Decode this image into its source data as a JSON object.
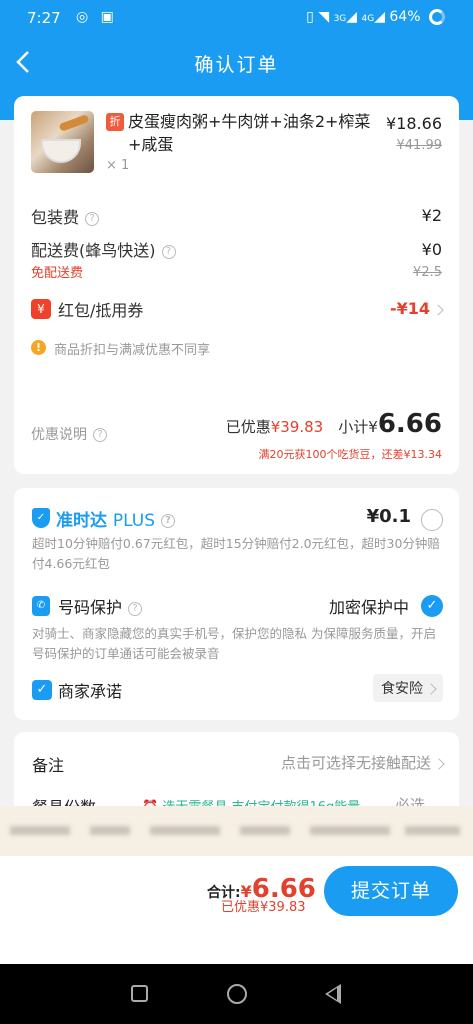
{
  "status": {
    "time": "7:27",
    "battery": "64%",
    "net1": "3G",
    "net2": "4G"
  },
  "nav": {
    "title": "确认订单"
  },
  "product": {
    "badge": "折",
    "name": "皮蛋瘦肉粥+牛肉饼+油条2+榨菜+咸蛋",
    "qty": "× 1",
    "price": "¥18.66",
    "orig_price": "¥41.99"
  },
  "fees": {
    "packing_label": "包装费",
    "packing_value": "¥2",
    "delivery_label": "配送费(蜂鸟快送)",
    "delivery_value": "¥0",
    "free_delivery": "免配送费",
    "delivery_orig": "¥2.5",
    "coupon_badge": "¥",
    "coupon_label": "红包/抵用券",
    "coupon_value": "-¥14",
    "notice": "商品折扣与满减优惠不同享"
  },
  "summary": {
    "desc_label": "优惠说明",
    "saved_prefix": "已优惠",
    "saved_value": "¥39.83",
    "subtotal_prefix": "小计¥",
    "subtotal_value": "6.66",
    "promo": "满20元获100个吃货豆，还差¥13.34"
  },
  "ontime": {
    "title": "准时达",
    "plus": "PLUS",
    "price": "¥0.1",
    "desc": "超时10分钟赔付0.67元红包，超时15分钟赔付2.0元红包，超时30分钟赔付4.66元红包"
  },
  "privacy": {
    "title": "号码保护",
    "status": "加密保护中",
    "desc": "对骑士、商家隐藏您的真实手机号，保护您的隐私 为保障服务质量，开启号码保护的订单通话可能会被录音"
  },
  "merchant": {
    "title": "商家承诺",
    "tag": "食安险"
  },
  "notes": {
    "label": "备注",
    "placeholder": "点击可选择无接触配送"
  },
  "utensils": {
    "label": "餐具份数",
    "hint": "选无需餐具,支付宝付款得16g能量",
    "value": "必选"
  },
  "footer": {
    "total_label": "合计:",
    "total_symbol": "¥",
    "total_value": "6.66",
    "saved": "已优惠¥39.83",
    "submit": "提交订单"
  },
  "colors": {
    "brand": "#1a9cf2",
    "red": "#e2412d",
    "teal": "#2bb58a"
  }
}
